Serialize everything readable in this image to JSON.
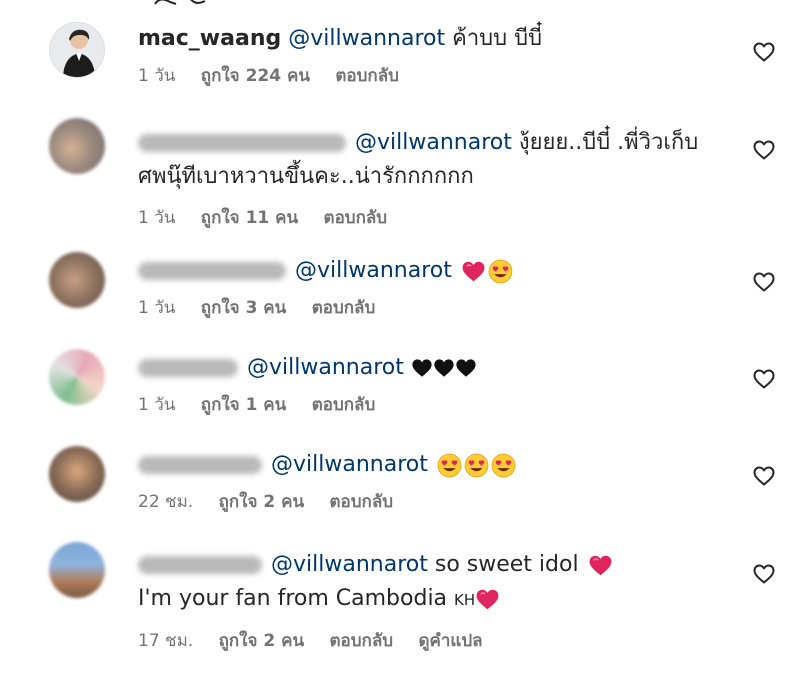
{
  "comments": [
    {
      "username": "mac_waang",
      "mention": "@villwannarot",
      "text": "ค้าบบ บีบี๋",
      "time": "1 วัน",
      "likes": "ถูกใจ 224 คน",
      "reply": "ตอบกลับ"
    },
    {
      "mention": "@villwannarot",
      "text": "งุ้ยยย..บีบี๋ .พี่วิวเก็บ",
      "text2": "ศพนุ๊ทีเบาหวานขึ้นคะ..น่ารักกกกกก",
      "time": "1 วัน",
      "likes": "ถูกใจ 11 คน",
      "reply": "ตอบกลับ"
    },
    {
      "mention": "@villwannarot",
      "time": "1 วัน",
      "likes": "ถูกใจ 3 คน",
      "reply": "ตอบกลับ"
    },
    {
      "mention": "@villwannarot",
      "time": "1 วัน",
      "likes": "ถูกใจ 1 คน",
      "reply": "ตอบกลับ"
    },
    {
      "mention": "@villwannarot",
      "time": "22 ชม.",
      "likes": "ถูกใจ 2 คน",
      "reply": "ตอบกลับ"
    },
    {
      "mention": "@villwannarot",
      "text": "so sweet idol",
      "text2": "I'm your fan from Cambodia",
      "flag": "KH",
      "time": "17 ชม.",
      "likes": "ถูกใจ 2 คน",
      "reply": "ตอบกลับ",
      "translate": "ดูคำแปล"
    }
  ],
  "icons": {
    "like": "heart-outline-icon",
    "red_heart": "red-heart-emoji",
    "black_heart": "black-heart-emoji",
    "heart_eyes": "heart-eyes-emoji"
  },
  "colors": {
    "mention": "#00376b",
    "meta": "#737373",
    "text": "#262626",
    "red_heart": "#e0245e",
    "emoji_yellow": "#ffcc33"
  }
}
